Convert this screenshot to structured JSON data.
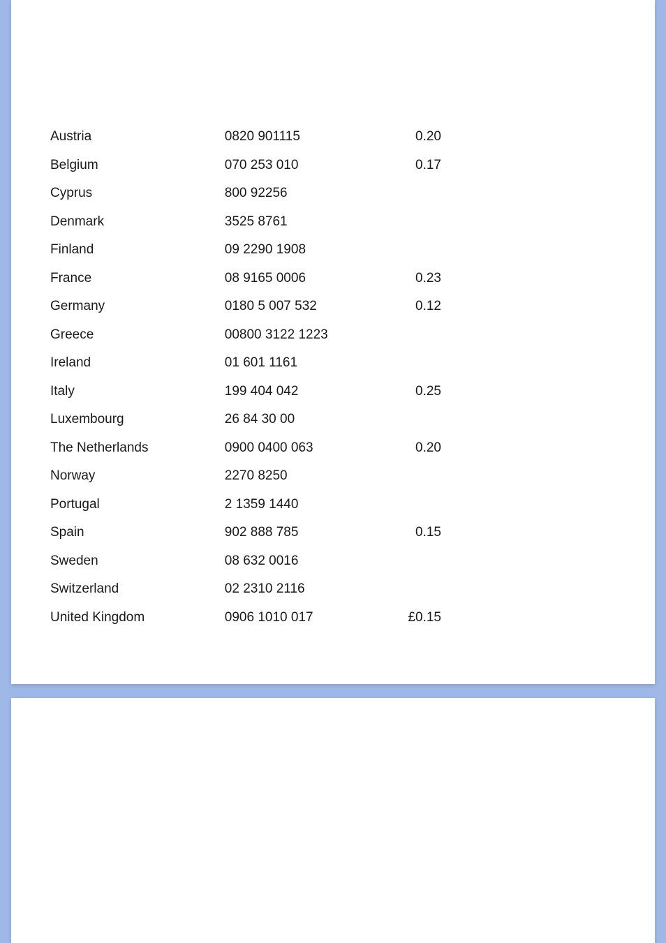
{
  "rows": [
    {
      "country": "Austria",
      "number": "0820 901115",
      "cost": "0.20"
    },
    {
      "country": "Belgium",
      "number": "070 253 010",
      "cost": "0.17"
    },
    {
      "country": "Cyprus",
      "number": "800 92256",
      "cost": ""
    },
    {
      "country": "Denmark",
      "number": "3525 8761",
      "cost": ""
    },
    {
      "country": "Finland",
      "number": "09 2290 1908",
      "cost": ""
    },
    {
      "country": "France",
      "number": "08 9165 0006",
      "cost": "0.23"
    },
    {
      "country": "Germany",
      "number": "0180 5 007 532",
      "cost": "0.12"
    },
    {
      "country": "Greece",
      "number": "00800 3122 1223",
      "cost": ""
    },
    {
      "country": "Ireland",
      "number": "01 601 1161",
      "cost": ""
    },
    {
      "country": "Italy",
      "number": "199 404 042",
      "cost": "0.25"
    },
    {
      "country": "Luxembourg",
      "number": "26 84 30 00",
      "cost": ""
    },
    {
      "country": "The Netherlands",
      "number": "0900 0400 063",
      "cost": "0.20"
    },
    {
      "country": "Norway",
      "number": "2270 8250",
      "cost": ""
    },
    {
      "country": "Portugal",
      "number": "2 1359 1440",
      "cost": ""
    },
    {
      "country": "Spain",
      "number": "902 888 785",
      "cost": "0.15"
    },
    {
      "country": "Sweden",
      "number": "08 632 0016",
      "cost": ""
    },
    {
      "country": "Switzerland",
      "number": "02 2310 2116",
      "cost": ""
    },
    {
      "country": "United Kingdom",
      "number": "0906 1010 017",
      "cost": "£0.15"
    }
  ]
}
